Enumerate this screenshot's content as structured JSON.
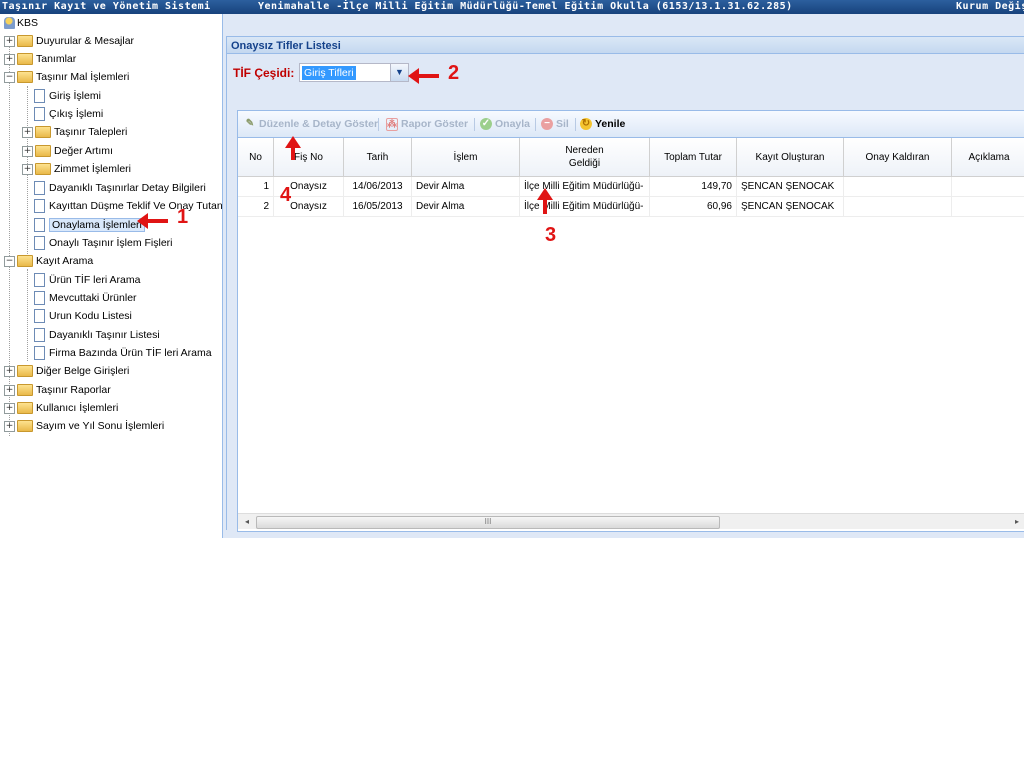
{
  "topbar": {
    "left": "Taşınır Kayıt ve Yönetim Sistemi",
    "center": "Yenimahalle -İlçe Milli Eğitim Müdürlüğü-Temel Eğitim Okulla (6153/13.1.31.62.285)",
    "right": "Kurum Değiş"
  },
  "sidebar": {
    "root": "KBS",
    "items": [
      {
        "label": "Duyurular & Mesajlar"
      },
      {
        "label": "Tanımlar"
      },
      {
        "label": "Taşınır Mal İşlemleri"
      },
      {
        "label": "Giriş İşlemi"
      },
      {
        "label": "Çıkış İşlemi"
      },
      {
        "label": "Taşınır Talepleri"
      },
      {
        "label": "Değer Artımı"
      },
      {
        "label": "Zimmet İşlemleri"
      },
      {
        "label": "Dayanıklı Taşınırlar Detay Bilgileri"
      },
      {
        "label": "Kayıttan Düşme Teklif Ve Onay Tutanağı"
      },
      {
        "label": "Onaylama İşlemleri"
      },
      {
        "label": "Onaylı Taşınır İşlem Fişleri"
      },
      {
        "label": "Kayıt Arama"
      },
      {
        "label": "Ürün TİF leri Arama"
      },
      {
        "label": "Mevcuttaki Ürünler"
      },
      {
        "label": "Urun Kodu Listesi"
      },
      {
        "label": "Dayanıklı Taşınır Listesi"
      },
      {
        "label": "Firma Bazında Ürün TİF leri Arama"
      },
      {
        "label": "Diğer Belge Girişleri"
      },
      {
        "label": "Taşınır Raporlar"
      },
      {
        "label": "Kullanıcı İşlemleri"
      },
      {
        "label": "Sayım ve Yıl Sonu İşlemleri"
      }
    ]
  },
  "panel": {
    "title": "Onaysız Tifler Listesi",
    "tif_label": "TİF Çeşidi:",
    "tif_value": "Giriş Tifleri"
  },
  "toolbar": {
    "edit": "Düzenle & Detay Göster",
    "report": "Rapor Göster",
    "approve": "Onayla",
    "delete": "Sil",
    "refresh": "Yenile"
  },
  "grid": {
    "columns": [
      "No",
      "Fiş No",
      "Tarih",
      "İşlem",
      "Nereden Geldiği",
      "Toplam Tutar",
      "Kayıt Oluşturan",
      "Onay Kaldıran",
      "Açıklama"
    ],
    "rows": [
      {
        "no": "1",
        "fis": "Onaysız",
        "tarih": "14/06/2013",
        "islem": "Devir Alma",
        "nereden": "İlçe Milli Eğitim Müdürlüğü-",
        "tutar": "149,70",
        "olusturan": "ŞENCAN ŞENOCAK",
        "kaldiran": "",
        "aciklama": ""
      },
      {
        "no": "2",
        "fis": "Onaysız",
        "tarih": "16/05/2013",
        "islem": "Devir Alma",
        "nereden": "İlçe Milli Eğitim Müdürlüğü-",
        "tutar": "60,96",
        "olusturan": "ŞENCAN ŞENOCAK",
        "kaldiran": "",
        "aciklama": ""
      }
    ],
    "scroll_thumb": "III"
  },
  "annotations": {
    "a1": "1",
    "a2": "2",
    "a3": "3",
    "a4": "4"
  },
  "colors": {
    "accent": "#15428b",
    "annotation": "#e01414",
    "tif_label": "#c00000"
  }
}
